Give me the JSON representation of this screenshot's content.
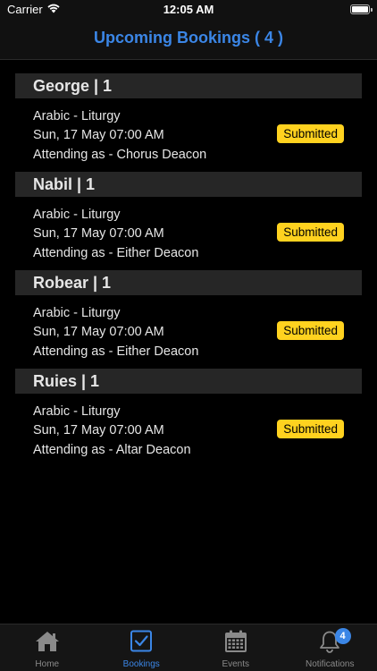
{
  "status_bar": {
    "carrier": "Carrier",
    "time": "12:05 AM"
  },
  "header": {
    "title": "Upcoming Bookings ( 4 )"
  },
  "groups": [
    {
      "header": "George | 1",
      "booking": {
        "event": "Arabic - Liturgy",
        "datetime": "Sun, 17 May 07:00 AM",
        "role": "Attending as - Chorus Deacon",
        "status": "Submitted"
      }
    },
    {
      "header": "Nabil | 1",
      "booking": {
        "event": "Arabic - Liturgy",
        "datetime": "Sun, 17 May 07:00 AM",
        "role": "Attending as - Either Deacon",
        "status": "Submitted"
      }
    },
    {
      "header": "Robear | 1",
      "booking": {
        "event": "Arabic - Liturgy",
        "datetime": "Sun, 17 May 07:00 AM",
        "role": "Attending as - Either Deacon",
        "status": "Submitted"
      }
    },
    {
      "header": "Ruies | 1",
      "booking": {
        "event": "Arabic - Liturgy",
        "datetime": "Sun, 17 May 07:00 AM",
        "role": "Attending as - Altar Deacon",
        "status": "Submitted"
      }
    }
  ],
  "tabs": [
    {
      "label": "Home",
      "icon": "home-icon"
    },
    {
      "label": "Bookings",
      "icon": "checkbox-icon",
      "active": true
    },
    {
      "label": "Events",
      "icon": "calendar-icon"
    },
    {
      "label": "Notifications",
      "icon": "bell-icon",
      "badge": "4"
    }
  ],
  "colors": {
    "accent": "#3b86e6",
    "status_badge": "#ffd21f",
    "section_header": "#262626",
    "background": "#000000"
  }
}
